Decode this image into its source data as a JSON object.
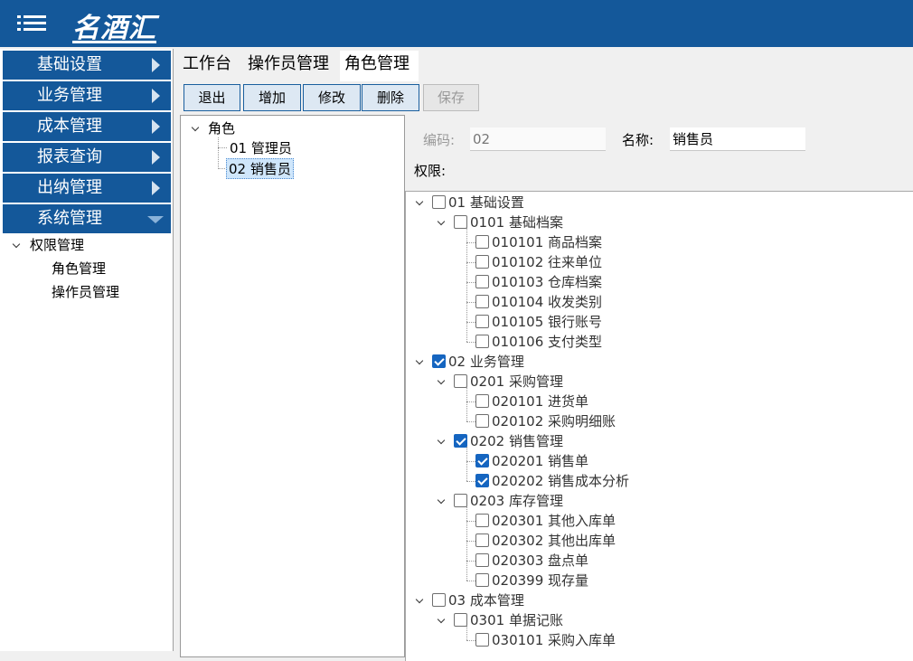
{
  "app": {
    "title": "名酒汇",
    "menu_icon": "hamburger-menu-icon"
  },
  "sidebar": {
    "items": [
      {
        "label": "基础设置",
        "expanded": false
      },
      {
        "label": "业务管理",
        "expanded": false
      },
      {
        "label": "成本管理",
        "expanded": false
      },
      {
        "label": "报表查询",
        "expanded": false
      },
      {
        "label": "出纳管理",
        "expanded": false
      },
      {
        "label": "系统管理",
        "expanded": true
      }
    ],
    "subtree": {
      "group": "权限管理",
      "children": [
        "角色管理",
        "操作员管理"
      ]
    }
  },
  "tabs": [
    {
      "label": "工作台",
      "active": false
    },
    {
      "label": "操作员管理",
      "active": false
    },
    {
      "label": "角色管理",
      "active": true
    }
  ],
  "toolbar": {
    "exit": "退出",
    "add": "增加",
    "edit": "修改",
    "delete": "删除",
    "save": "保存"
  },
  "roles": {
    "root": "角色",
    "items": [
      "01 管理员",
      "02 销售员"
    ],
    "selected": "02 销售员"
  },
  "detail": {
    "code_label": "编码:",
    "code_value": "02",
    "name_label": "名称:",
    "name_value": "销售员",
    "perm_label": "权限:"
  },
  "permissions": [
    {
      "label": "01 基础设置",
      "level": 0,
      "checked": false,
      "expanded": true
    },
    {
      "label": "0101 基础档案",
      "level": 1,
      "checked": false,
      "expanded": true
    },
    {
      "label": "010101 商品档案",
      "level": 2,
      "checked": false
    },
    {
      "label": "010102 往来单位",
      "level": 2,
      "checked": false
    },
    {
      "label": "010103 仓库档案",
      "level": 2,
      "checked": false
    },
    {
      "label": "010104 收发类别",
      "level": 2,
      "checked": false
    },
    {
      "label": "010105 银行账号",
      "level": 2,
      "checked": false
    },
    {
      "label": "010106 支付类型",
      "level": 2,
      "checked": false
    },
    {
      "label": "02 业务管理",
      "level": 0,
      "checked": true,
      "expanded": true
    },
    {
      "label": "0201 采购管理",
      "level": 1,
      "checked": false,
      "expanded": true
    },
    {
      "label": "020101 进货单",
      "level": 2,
      "checked": false
    },
    {
      "label": "020102 采购明细账",
      "level": 2,
      "checked": false
    },
    {
      "label": "0202 销售管理",
      "level": 1,
      "checked": true,
      "expanded": true
    },
    {
      "label": "020201 销售单",
      "level": 2,
      "checked": true
    },
    {
      "label": "020202 销售成本分析",
      "level": 2,
      "checked": true
    },
    {
      "label": "0203 库存管理",
      "level": 1,
      "checked": false,
      "expanded": true
    },
    {
      "label": "020301 其他入库单",
      "level": 2,
      "checked": false
    },
    {
      "label": "020302 其他出库单",
      "level": 2,
      "checked": false
    },
    {
      "label": "020303 盘点单",
      "level": 2,
      "checked": false
    },
    {
      "label": "020399 现存量",
      "level": 2,
      "checked": false
    },
    {
      "label": "03 成本管理",
      "level": 0,
      "checked": false,
      "expanded": true
    },
    {
      "label": "0301 单据记账",
      "level": 1,
      "checked": false,
      "expanded": true
    },
    {
      "label": "030101 采购入库单",
      "level": 2,
      "checked": false
    }
  ]
}
